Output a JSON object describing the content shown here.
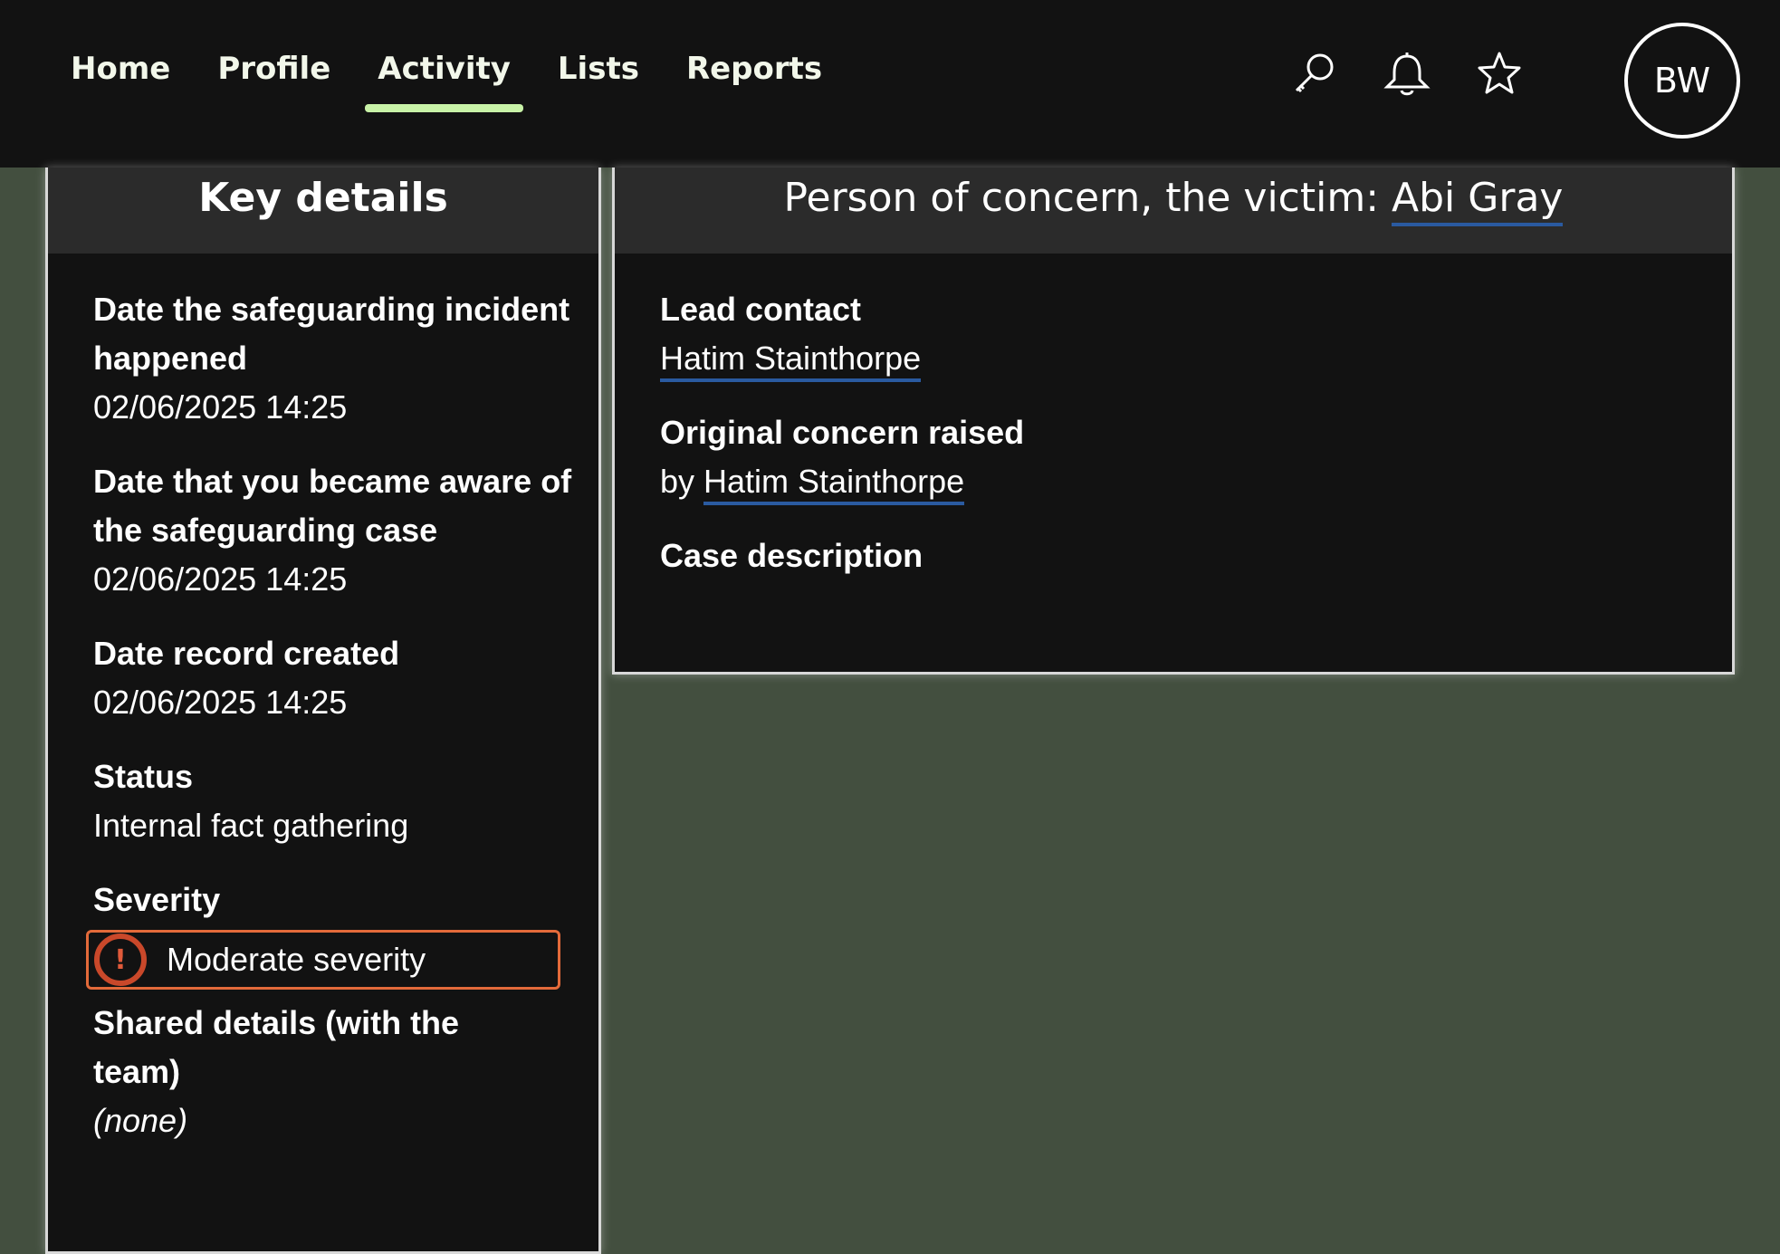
{
  "nav": {
    "items": [
      {
        "label": "Home",
        "active": false
      },
      {
        "label": "Profile",
        "active": false
      },
      {
        "label": "Activity",
        "active": true
      },
      {
        "label": "Lists",
        "active": false
      },
      {
        "label": "Reports",
        "active": false
      }
    ]
  },
  "header_icons": [
    "search-icon",
    "bell-icon",
    "star-icon"
  ],
  "user": {
    "initials": "BW"
  },
  "key_details": {
    "title": "Key details",
    "incident_date_label": "Date the safeguarding incident happened",
    "incident_date_value": "02/06/2025 14:25",
    "aware_date_label": "Date that you became aware of the safeguarding case",
    "aware_date_value": "02/06/2025 14:25",
    "created_label": "Date record created",
    "created_value": "02/06/2025 14:25",
    "status_label": "Status",
    "status_value": "Internal fact gathering",
    "severity_label": "Severity",
    "severity_value": "Moderate severity",
    "shared_label": "Shared details (with the team)",
    "shared_value": "(none)"
  },
  "person": {
    "title_prefix": "Person of concern, the victim: ",
    "name": "Abi Gray",
    "lead_contact_label": "Lead contact",
    "lead_contact_value": "Hatim Stainthorpe",
    "original_concern_label": "Original concern raised",
    "original_concern_prefix": "by ",
    "original_concern_value": "Hatim Stainthorpe",
    "case_description_label": "Case description"
  },
  "colors": {
    "background": "#434f3f",
    "topbar": "#121212",
    "active_tab": "#c8f2a7",
    "link_underline": "#2a5aa0",
    "severity": "#e36a3a"
  }
}
